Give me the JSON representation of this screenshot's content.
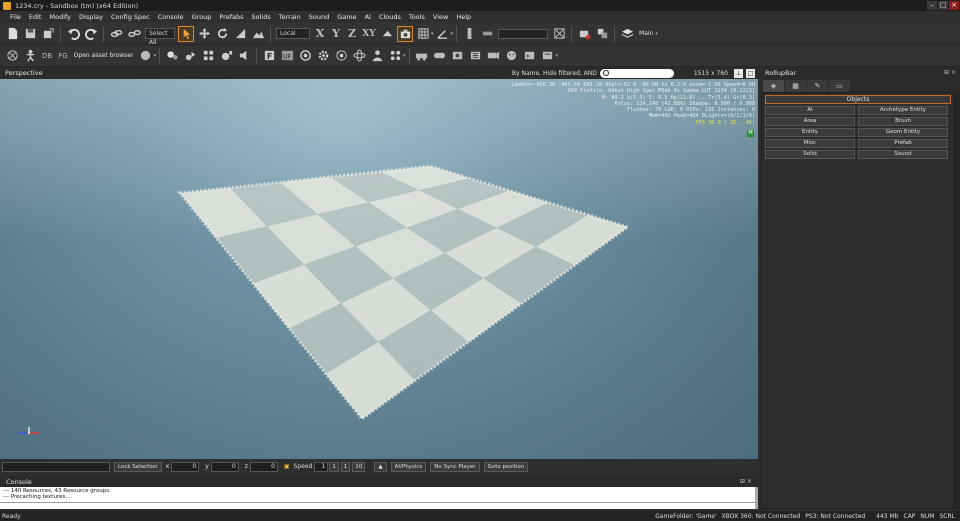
{
  "title_bar": {
    "title": "1234.cry - Sandbox (tm) (x64 Edition)",
    "min": "–",
    "max": "□",
    "close": "×"
  },
  "menu": [
    "File",
    "Edit",
    "Modify",
    "Display",
    "Config Spec",
    "Console",
    "Group",
    "Prefabs",
    "Solids",
    "Terrain",
    "Sound",
    "Game",
    "AI",
    "Clouds",
    "Tools",
    "View",
    "Help"
  ],
  "toolbar": {
    "select_all": "Select All",
    "coord_system": "Local",
    "axis_x": "X",
    "axis_y": "Y",
    "axis_z": "Z",
    "axis_xy": "XY",
    "layer": "Main",
    "db": "DB",
    "fg": "FG",
    "asset_browser": "Open asset browser"
  },
  "viewport": {
    "title": "Perspective",
    "filter": "By Name, Hide filtered, AND",
    "search_placeholder": "",
    "resolution": "1515 x 760",
    "stats": [
      "CamPos=-456.30 -467.64 603.20 Angl=-52  0 -89 DB to 0.2:0 zoom=-1.00 Speed=0.00",
      "DX9 Profile: 64bit High Spec MSAA 4x Gamma LUT 1234 [0.2213]",
      "M: 89.2 b(5.5)  S: 0.5 Hp(11.8)  ...Tr(5.4) Gr(0.3)",
      "Polys: 124,240 (42,880)  Shadow: 0.000 / 0.000",
      "Flushes: 70 LOD: 0 DIPs: 156  Instances: 0",
      "Mem=442  Peak=464  DLights=(0/1/1/0)",
      "FPS  30.0 ( 35.. 46)"
    ],
    "badge": "M"
  },
  "rollup": {
    "title": "RollupBar",
    "pin": "⊞ ×",
    "header": "Objects",
    "buttons": [
      "AI",
      "Archetype Entity",
      "Area",
      "Brush",
      "Entity",
      "Geom Entity",
      "Misc",
      "Prefab",
      "Solid",
      "Sound"
    ]
  },
  "statusrow": {
    "lock_selection": "Lock Selection",
    "x_label": "x",
    "x": "0",
    "y_label": "y",
    "y": "0",
    "z_label": "z",
    "z": "0",
    "speed_label": "Speed",
    "speed": "1",
    "s1": "1",
    "s2": "1",
    "s3": "10",
    "ai_physics": "AI/Physics",
    "no_sync": "No Sync Player",
    "goto": "Goto position"
  },
  "console": {
    "title": "Console",
    "pin": "⊞ ×",
    "lines": [
      "--- 140 Resources, 43 Resource groups.",
      "--- Precaching textures..."
    ]
  },
  "statusbar": {
    "ready": "Ready",
    "game_folder": "GameFolder: 'Game'",
    "xbox": "XBOX 360: Not Connected",
    "ps3": "PS3: Not Connected",
    "mem": "443 Mb",
    "cap": "CAP",
    "num": "NUM",
    "scrl": "SCRL"
  },
  "colors": {
    "accent": "#d88a2a",
    "sky_top": "#8fb1bf",
    "sky_bottom": "#4c6b7b",
    "ground_tile_light": "#e8e8e0",
    "fps": "#e3e34a"
  }
}
